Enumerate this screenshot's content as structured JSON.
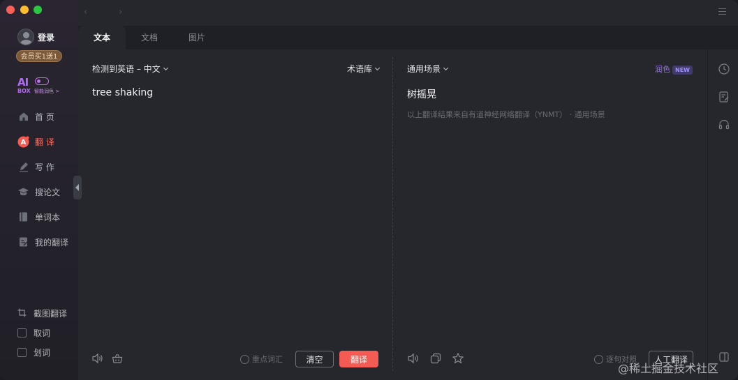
{
  "window": {
    "menu_icon": "hamburger-icon",
    "back_icon": "chevron-left-icon",
    "forward_icon": "chevron-right-icon",
    "nav_back": "‹",
    "nav_forward": "›"
  },
  "sidebar": {
    "login_label": "登录",
    "vip_badge": "会员买1送1",
    "aibox": {
      "ai": "AI",
      "box": "BOX",
      "subtitle": "智能润色 >"
    },
    "nav": [
      {
        "label": "首 页",
        "icon": "home-icon"
      },
      {
        "label": "翻 译",
        "icon": "translate-icon",
        "active": true
      },
      {
        "label": "写 作",
        "icon": "pen-icon"
      },
      {
        "label": "搜论文",
        "icon": "graduation-cap-icon"
      },
      {
        "label": "单词本",
        "icon": "notebook-icon"
      },
      {
        "label": "我的翻译",
        "icon": "document-edit-icon"
      }
    ],
    "tools": [
      {
        "label": "截图翻译",
        "icon": "crop-icon"
      },
      {
        "label": "取词",
        "icon": "checkbox-icon"
      },
      {
        "label": "划词",
        "icon": "checkbox-icon"
      }
    ]
  },
  "tabs": [
    {
      "label": "文本",
      "active": true
    },
    {
      "label": "文档",
      "active": false
    },
    {
      "label": "图片",
      "active": false
    }
  ],
  "source": {
    "language_selector": "检测到英语 – 中文",
    "glossary_selector": "术语库",
    "text": "tree shaking",
    "key_terms_option": "重点词汇",
    "clear_button": "清空",
    "translate_button": "翻译"
  },
  "target": {
    "scene_selector": "通用场景",
    "polish_label": "润色",
    "new_badge": "NEW",
    "text": "树摇晃",
    "source_note": "以上翻译结果来自有道神经网络翻译（YNMT） · 通用场景",
    "sentence_align_option": "逐句对照",
    "human_translation_button": "人工翻译"
  },
  "right_rail": [
    {
      "icon": "history-clock-icon"
    },
    {
      "icon": "notes-edit-icon"
    },
    {
      "icon": "headset-icon"
    }
  ],
  "watermark": "@稀土掘金技术社区",
  "colors": {
    "accent_red": "#f45b52",
    "active_nav": "#ff6b62",
    "polish_purple": "#9b6ff2",
    "ai_purple": "#b06cf0",
    "background": "#25272d"
  }
}
